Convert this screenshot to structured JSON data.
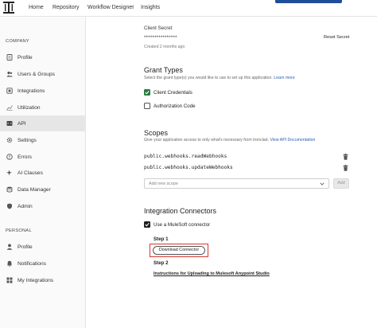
{
  "topnav": {
    "items": [
      "Home",
      "Repository",
      "Workflow Designer",
      "Insights"
    ]
  },
  "sidebar": {
    "company_label": "COMPANY",
    "company_items": [
      {
        "label": "Profile",
        "icon": "document-icon"
      },
      {
        "label": "Users & Groups",
        "icon": "users-icon"
      },
      {
        "label": "Integrations",
        "icon": "integrations-icon"
      },
      {
        "label": "Utilization",
        "icon": "chart-icon"
      },
      {
        "label": "API",
        "icon": "code-icon",
        "active": true
      },
      {
        "label": "Settings",
        "icon": "gear-icon"
      },
      {
        "label": "Errors",
        "icon": "error-icon"
      },
      {
        "label": "AI Clauses",
        "icon": "sparkle-icon"
      },
      {
        "label": "Data Manager",
        "icon": "database-icon"
      },
      {
        "label": "Admin",
        "icon": "admin-icon"
      }
    ],
    "personal_label": "PERSONAL",
    "personal_items": [
      {
        "label": "Profile",
        "icon": "person-icon"
      },
      {
        "label": "Notifications",
        "icon": "bell-icon"
      },
      {
        "label": "My Integrations",
        "icon": "grid-icon"
      }
    ]
  },
  "client_secret": {
    "label": "Client Secret",
    "value": "****************",
    "created": "Created 2 months ago",
    "reset_label": "Reset Secret"
  },
  "grant_types": {
    "title": "Grant Types",
    "description": "Select the grant type(s) you would like to use to set up this application.",
    "learn_more": "Learn more",
    "options": [
      {
        "label": "Client Credentials",
        "checked": true
      },
      {
        "label": "Authorization Code",
        "checked": false
      }
    ]
  },
  "scopes": {
    "title": "Scopes",
    "description": "Give your application access to only what's necessary from Ironclad.",
    "doc_link": "View API Documentation",
    "items": [
      "public.webhooks.readWebhooks",
      "public.webhooks.updateWebhooks"
    ],
    "add_placeholder": "Add new scope",
    "add_button": "Add"
  },
  "integration_connectors": {
    "title": "Integration Connectors",
    "use_mulesoft_label": "Use a MuleSoft connector",
    "use_mulesoft_checked": true,
    "step1_label": "Step 1",
    "download_button": "Download Connector",
    "step2_label": "Step 2",
    "instructions_link": "Instructions for Uploading to Mulesoft Anypoint Studio"
  },
  "colors": {
    "accent_blue": "#1f4e99",
    "check_green": "#2a7b43",
    "highlight_red": "#d23a2f",
    "link_blue": "#2a5db0"
  }
}
